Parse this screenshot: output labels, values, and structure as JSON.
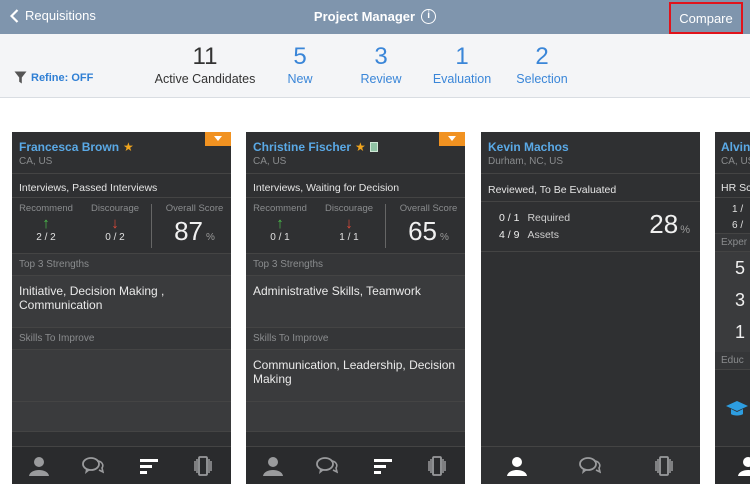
{
  "topbar": {
    "back_label": "Requisitions",
    "title": "Project Manager",
    "info_glyph": "i",
    "compare_label": "Compare"
  },
  "refine": {
    "label": "Refine: OFF"
  },
  "stats": [
    {
      "num": "11",
      "label": "Active Candidates"
    },
    {
      "num": "5",
      "label": "New"
    },
    {
      "num": "3",
      "label": "Review"
    },
    {
      "num": "1",
      "label": "Evaluation"
    },
    {
      "num": "2",
      "label": "Selection"
    }
  ],
  "cards": [
    {
      "name": "Francesca Brown",
      "location": "CA, US",
      "status": "Interviews, Passed Interviews",
      "recommend_label": "Recommend",
      "recommend_count": "2 / 2",
      "discourage_label": "Discourage",
      "discourage_count": "0 / 2",
      "overall_label": "Overall Score",
      "overall_score": "87",
      "pct": "%",
      "strengths_label": "Top 3 Strengths",
      "strengths": "Initiative, Decision Making , Communication",
      "improve_label": "Skills To Improve",
      "improve": ""
    },
    {
      "name": "Christine Fischer",
      "location": "CA, US",
      "status": "Interviews, Waiting for Decision",
      "recommend_label": "Recommend",
      "recommend_count": "0 / 1",
      "discourage_label": "Discourage",
      "discourage_count": "1 / 1",
      "overall_label": "Overall Score",
      "overall_score": "65",
      "pct": "%",
      "strengths_label": "Top 3 Strengths",
      "strengths": "Administrative Skills, Teamwork",
      "improve_label": "Skills To Improve",
      "improve": "Communication, Leadership, Decision Making"
    },
    {
      "name": "Kevin Machos",
      "location": "Durham, NC, US",
      "status": "Reviewed, To Be Evaluated",
      "required_count": "0 / 1",
      "required_label": "Required",
      "assets_count": "4 / 9",
      "assets_label": "Assets",
      "score": "28",
      "pct": "%"
    },
    {
      "name": "Alvin",
      "location": "CA, US",
      "status": "HR Sc",
      "line1": "1 /",
      "line2": "6 /",
      "section": "Exper",
      "n1": "5",
      "n2": "3",
      "n3": "1",
      "section2": "Educ"
    }
  ]
}
